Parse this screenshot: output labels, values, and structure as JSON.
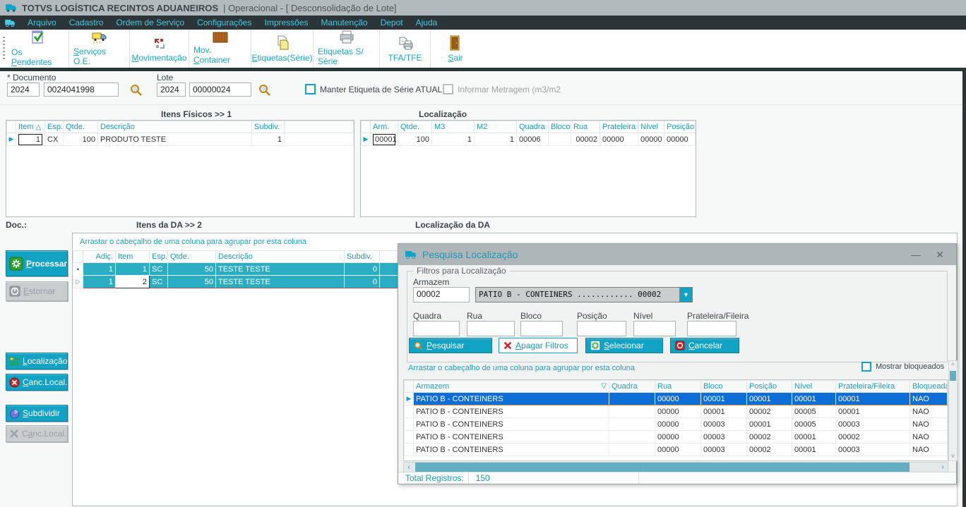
{
  "window": {
    "title_app": "TOTVS LOGÍSTICA RECINTOS ADUANEIROS",
    "title_rest": "| Operacional - [ Desconsolidação de Lote]"
  },
  "menu": {
    "items": [
      "Arquivo",
      "Cadastro",
      "Ordem de Serviço",
      "Configurações",
      "Impressões",
      "Manutenção",
      "Depot",
      "Ajuda"
    ]
  },
  "toolbar": {
    "buttons": [
      {
        "label": "Os Pendentes"
      },
      {
        "label": "Serviços O.E."
      },
      {
        "label": "Movimentação"
      },
      {
        "label": "Mov. Container"
      },
      {
        "label": "Etiquetas(Série)"
      },
      {
        "label": "Etiquetas S/ Série"
      },
      {
        "label": "TFA/TFE"
      },
      {
        "label": "Sair"
      }
    ]
  },
  "form": {
    "documento_label": "* Documento",
    "documento_ano": "2024",
    "documento_numero": "0024041998",
    "lote_label": "Lote",
    "lote_ano": "2024",
    "lote_numero": "00000024",
    "manter_etiqueta_label": "Manter Etiqueta de Série ATUAL",
    "informar_metragem_label": "Informar Metragem (m3/m2"
  },
  "itens_fisicos": {
    "title": "Itens Físicos   >> 1",
    "sort_glyph": "△",
    "columns": [
      "Item",
      "Esp.",
      "Qtde.",
      "Descrição",
      "Subdiv."
    ],
    "row": [
      "1",
      "CX",
      "100",
      "PRODUTO TESTE",
      "1"
    ]
  },
  "localizacao": {
    "title": "Localização",
    "columns": [
      "Arm.",
      "Qtde.",
      "M3",
      "M2",
      "Quadra",
      "Bloco",
      "Rua",
      "Prateleira",
      "Nível",
      "Posição"
    ],
    "row": [
      "00001",
      "100",
      "1",
      "1",
      "00006",
      "",
      "00002",
      "00000",
      "00000",
      "00000"
    ]
  },
  "da": {
    "doc_label": "Doc.:",
    "itens_title": "Itens da DA   >> 2",
    "loc_title": "Localização da DA",
    "group_hint": "Arrastar o cabeçalho de uma coluna para agrupar por esta coluna",
    "columns": [
      "Adiç.",
      "Item",
      "Esp.",
      "Qtde.",
      "Descrição",
      "Subdiv."
    ],
    "rows": [
      [
        "1",
        "1",
        "SC",
        "50",
        "TESTE TESTE",
        "0"
      ],
      [
        "1",
        "2",
        "SC",
        "50",
        "TESTE TESTE",
        "0"
      ]
    ]
  },
  "side_buttons": {
    "processar": "Processar",
    "estornar": "Estornar",
    "localizacao": "Localização",
    "canc_local": "Canc.Local.",
    "subdividir": "Subdividir",
    "canc_local2": "Canc.Local."
  },
  "dialog": {
    "title": "Pesquisa Localização",
    "minimize_glyph": "—",
    "close_glyph": "✕",
    "filtros_title": "Filtros para Localização",
    "armazem_label": "Armazem",
    "armazem_value": "00002",
    "armazem_combo": "PATIO B - CONTEINERS ............ 00002",
    "combo_arrow": "▼",
    "filter_fields": [
      {
        "label": "Quadra"
      },
      {
        "label": "Rua"
      },
      {
        "label": "Bloco"
      },
      {
        "label": "Posição"
      },
      {
        "label": "Nível"
      },
      {
        "label": "Prateleira/Fileira"
      }
    ],
    "buttons": {
      "pesquisar": "Pesquisar",
      "apagar": "Apagar Filtros",
      "selecionar": "Selecionar",
      "cancelar": "Cancelar"
    },
    "group_hint": "Arrastar o cabeçalho de uma coluna para agrupar por esta coluna",
    "mostrar_bloqueados": "Mostrar bloqueados",
    "grid": {
      "sort_glyph": "▽",
      "columns": [
        "Armazem",
        "Quadra",
        "Rua",
        "Bloco",
        "Posição",
        "Nível",
        "Prateleira/Fileira",
        "Bloqueada?"
      ],
      "rows": [
        [
          "PATIO B - CONTEINERS",
          "",
          "00000",
          "00001",
          "00001",
          "00001",
          "00001",
          "NAO"
        ],
        [
          "PATIO B - CONTEINERS",
          "",
          "00000",
          "00001",
          "00002",
          "00005",
          "00001",
          "NAO"
        ],
        [
          "PATIO B - CONTEINERS",
          "",
          "00000",
          "00003",
          "00001",
          "00005",
          "00003",
          "NAO"
        ],
        [
          "PATIO B - CONTEINERS",
          "",
          "00000",
          "00003",
          "00002",
          "00001",
          "00002",
          "NAO"
        ],
        [
          "PATIO B - CONTEINERS",
          "",
          "00000",
          "00003",
          "00002",
          "00001",
          "00003",
          "NAO"
        ]
      ]
    },
    "status": {
      "total_label": "Total Registros:",
      "total_value": "150"
    }
  },
  "colors": {
    "accent_teal": "#12A3C4",
    "menu_cyan": "#45C9E3",
    "dark": "#2B3538",
    "row_teal": "#2BAEC2",
    "selected_blue": "#0D6ED6",
    "selected_border": "#E2872F"
  }
}
